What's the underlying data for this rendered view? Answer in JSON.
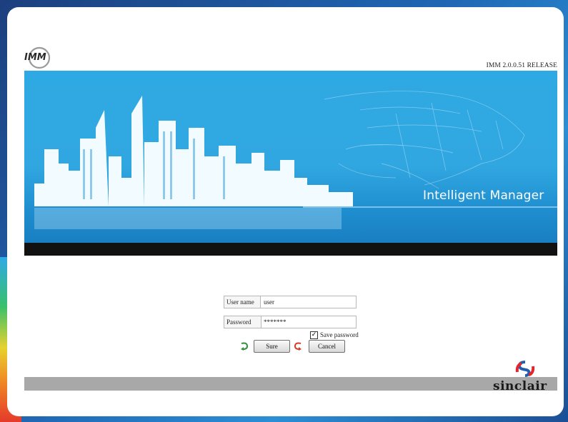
{
  "app": {
    "logo_text": "IMM",
    "version": "IMM 2.0.0.51 RELEASE"
  },
  "banner": {
    "title": "Intelligent Manager"
  },
  "login": {
    "username_label": "User name",
    "username_value": "user",
    "password_label": "Password",
    "password_value": "*******",
    "save_password_label": "Save password",
    "save_password_checked": true,
    "sure_label": "Sure",
    "cancel_label": "Cancel"
  },
  "brand": {
    "name": "sinclair"
  },
  "colors": {
    "banner_blue": "#2fa9e3",
    "black_bar": "#111111",
    "footer_gray": "#a8a8a8",
    "sinclair_blue": "#1f5fb0",
    "sinclair_red": "#e2262b",
    "sure_icon_green": "#2f8f3a",
    "cancel_icon_red": "#d23a2a"
  },
  "icons": {
    "logo": "imm-logo-icon",
    "sure": "green-return-arrow-icon",
    "cancel": "red-return-arrow-icon",
    "brand": "sinclair-s-logo-icon"
  }
}
